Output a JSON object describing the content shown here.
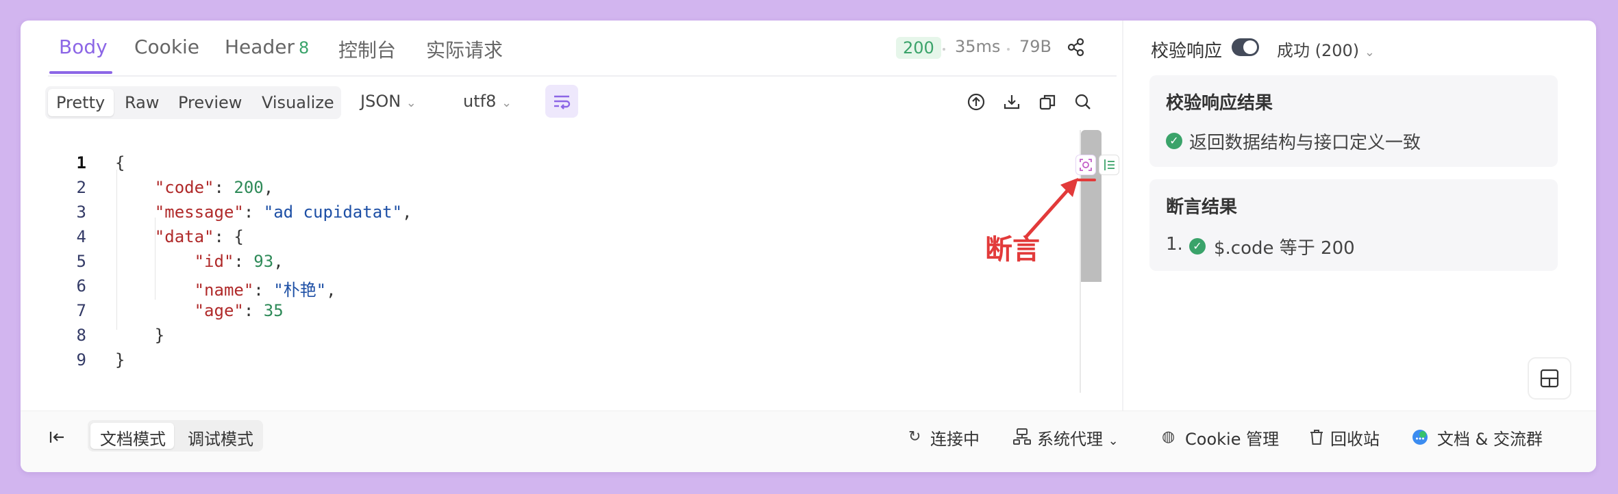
{
  "tabs": {
    "body": "Body",
    "cookie": "Cookie",
    "header": "Header",
    "header_count": "8",
    "console": "控制台",
    "actual_request": "实际请求"
  },
  "status": {
    "code": "200",
    "time": "35ms",
    "size": "79B"
  },
  "view_modes": [
    "Pretty",
    "Raw",
    "Preview",
    "Visualize"
  ],
  "format": "JSON",
  "encoding": "utf8",
  "code_lines": [
    {
      "n": "1"
    },
    {
      "n": "2"
    },
    {
      "n": "3"
    },
    {
      "n": "4"
    },
    {
      "n": "5"
    },
    {
      "n": "6"
    },
    {
      "n": "7"
    },
    {
      "n": "8"
    },
    {
      "n": "9"
    }
  ],
  "code": {
    "open_brace": "{",
    "code_key": "\"code\"",
    "code_val": "200",
    "message_key": "\"message\"",
    "message_val": "\"ad cupidatat\"",
    "data_key": "\"data\"",
    "data_open": "{",
    "id_key": "\"id\"",
    "id_val": "93",
    "name_key": "\"name\"",
    "name_val": "\"朴艳\"",
    "age_key": "\"age\"",
    "age_val": "35",
    "inner_close": "}",
    "close_brace": "}"
  },
  "annotation": "断言",
  "right_panel": {
    "validate_label": "校验响应",
    "result_select": "成功 (200)",
    "validate_result_title": "校验响应结果",
    "validate_result_text": "返回数据结构与接口定义一致",
    "assert_title": "断言结果",
    "assert_index": "1.",
    "assert_text": "$.code 等于 200"
  },
  "footer": {
    "doc_mode": "文档模式",
    "debug_mode": "调试模式",
    "connecting": "连接中",
    "proxy": "系统代理",
    "cookie_mgmt": "Cookie 管理",
    "recycle": "回收站",
    "docs_group": "文档 & 交流群"
  },
  "colors": {
    "accent": "#8c66e6",
    "success": "#3aa36a",
    "annotation": "#e23a3a",
    "background": "#d2b5ef"
  }
}
